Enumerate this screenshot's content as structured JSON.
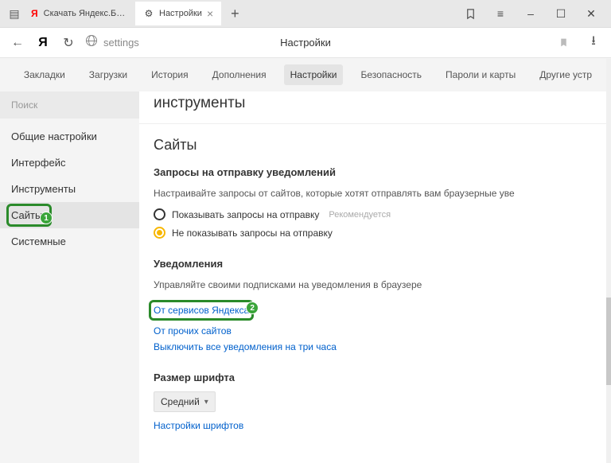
{
  "titlebar": {
    "tabs": [
      {
        "label": "Скачать Яндекс.Браузер д",
        "favicon": "Y"
      },
      {
        "label": "Настройки",
        "favicon": "gear"
      }
    ],
    "window_buttons": {
      "bookmark": "bookmark",
      "menu": "menu",
      "min": "min",
      "max": "max",
      "close": "close"
    }
  },
  "addressbar": {
    "url": "settings",
    "page_title": "Настройки"
  },
  "topnav": {
    "items": [
      "Закладки",
      "Загрузки",
      "История",
      "Дополнения",
      "Настройки",
      "Безопасность",
      "Пароли и карты",
      "Другие устр"
    ],
    "active": "Настройки"
  },
  "sidebar": {
    "search_placeholder": "Поиск",
    "items": [
      "Общие настройки",
      "Интерфейс",
      "Инструменты",
      "Сайты",
      "Системные"
    ],
    "active": "Сайты"
  },
  "panel": {
    "prev_section": "инструменты",
    "sites_heading": "Сайты",
    "notif_req": {
      "title": "Запросы на отправку уведомлений",
      "desc": "Настраивайте запросы от сайтов, которые хотят отправлять вам браузерные уве",
      "opt1": "Показывать запросы на отправку",
      "opt1_reco": "Рекомендуется",
      "opt2": "Не показывать запросы на отправку",
      "selected": 2
    },
    "notif": {
      "title": "Уведомления",
      "desc": "Управляйте своими подписками на уведомления в браузере",
      "link1": "От сервисов Яндекса",
      "link2": "От прочих сайтов",
      "link3": "Выключить все уведомления на три часа"
    },
    "font": {
      "title": "Размер шрифта",
      "value": "Средний",
      "link": "Настройки шрифтов"
    }
  },
  "annotations": {
    "n1": "1",
    "n2": "2"
  }
}
